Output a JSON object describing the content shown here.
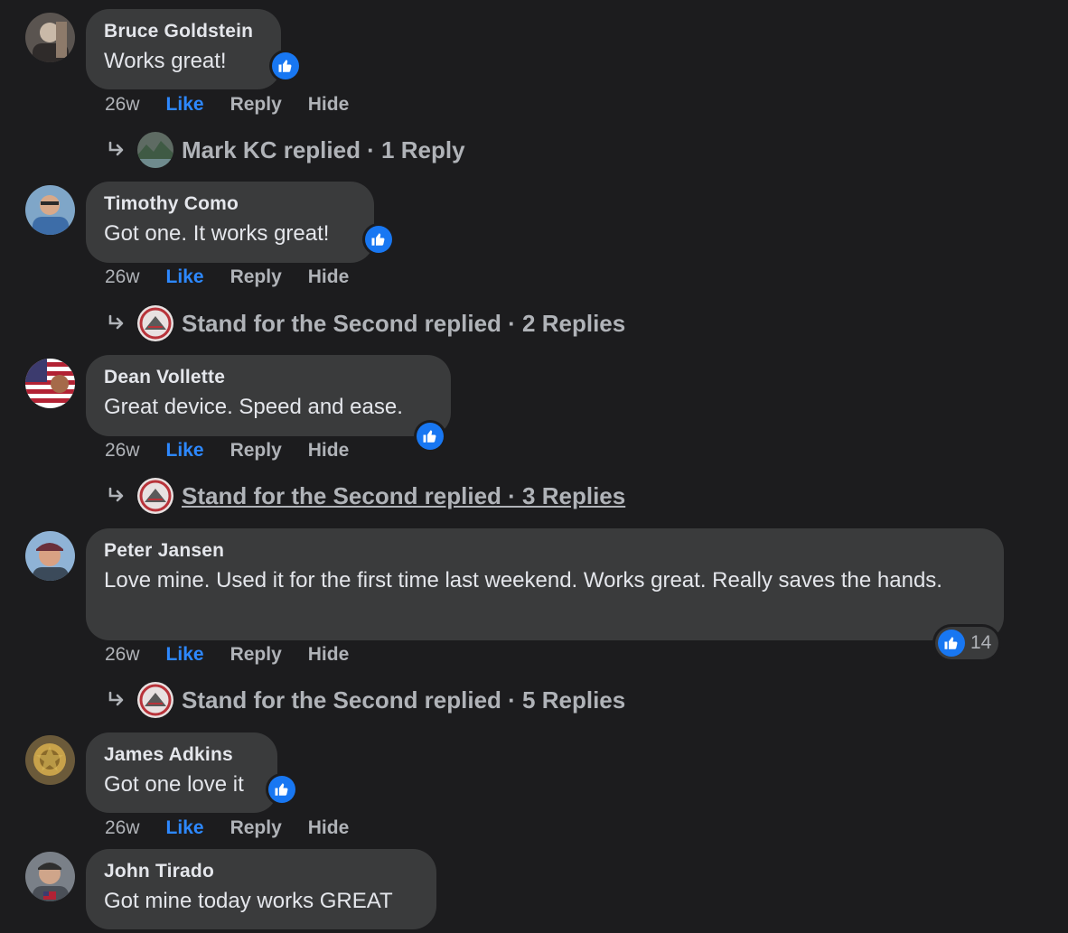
{
  "comments": [
    {
      "author": "Bruce Goldstein",
      "text": "Works great!",
      "time": "26w",
      "like": "Like",
      "reply": "Reply",
      "hide": "Hide",
      "replies": {
        "text": "Mark KC replied · 1 Reply"
      }
    },
    {
      "author": "Timothy Como",
      "text": "Got one. It works great!",
      "time": "26w",
      "like": "Like",
      "reply": "Reply",
      "hide": "Hide",
      "replies": {
        "text": "Stand for the Second replied · 2 Replies"
      }
    },
    {
      "author": "Dean Vollette",
      "text": "Great device. Speed and ease.",
      "time": "26w",
      "like": "Like",
      "reply": "Reply",
      "hide": "Hide",
      "replies": {
        "text": "Stand for the Second replied · 3 Replies"
      }
    },
    {
      "author": "Peter Jansen",
      "text": "Love mine. Used it for the first time last weekend. Works great. Really saves the hands.",
      "time": "26w",
      "like": "Like",
      "reply": "Reply",
      "hide": "Hide",
      "reaction_count": "14",
      "replies": {
        "text": "Stand for the Second replied · 5 Replies"
      }
    },
    {
      "author": "James Adkins",
      "text": "Got one love it",
      "time": "26w",
      "like": "Like",
      "reply": "Reply",
      "hide": "Hide"
    },
    {
      "author": "John Tirado",
      "text": "Got mine today works GREAT"
    }
  ],
  "colors": {
    "background": "#1c1c1e",
    "bubble": "#3a3b3c",
    "like_blue": "#2d88ff",
    "reaction_blue": "#1877f2",
    "muted_text": "#b0b3b8"
  },
  "icons": {
    "reaction": "thumbs-up-icon",
    "reply_arrow": "reply-arrow-icon"
  }
}
